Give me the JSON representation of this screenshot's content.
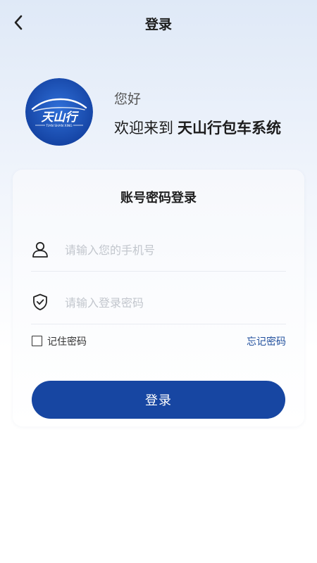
{
  "nav": {
    "back_icon": "chevron-left-icon",
    "title": "登录"
  },
  "logo": {
    "main_text": "天山行",
    "sub_text": "TIAN SHAN XING",
    "colors": {
      "inner": "#2f6fd8",
      "outer": "#123f9e"
    }
  },
  "header": {
    "greeting": "您好",
    "welcome_prefix": "欢迎来到",
    "app_name": "天山行包车系统"
  },
  "login_card": {
    "title": "账号密码登录",
    "phone": {
      "icon": "user-icon",
      "placeholder": "请输入您的手机号",
      "value": ""
    },
    "password": {
      "icon": "shield-check-icon",
      "placeholder": "请输入登录密码",
      "value": ""
    },
    "remember": {
      "label": "记住密码",
      "checked": false
    },
    "forgot_label": "忘记密码"
  },
  "submit": {
    "label": "登录",
    "color": "#1746a2"
  },
  "colors": {
    "accent": "#1746a2",
    "link": "#1f4e9c",
    "placeholder": "#c2c6cd"
  }
}
